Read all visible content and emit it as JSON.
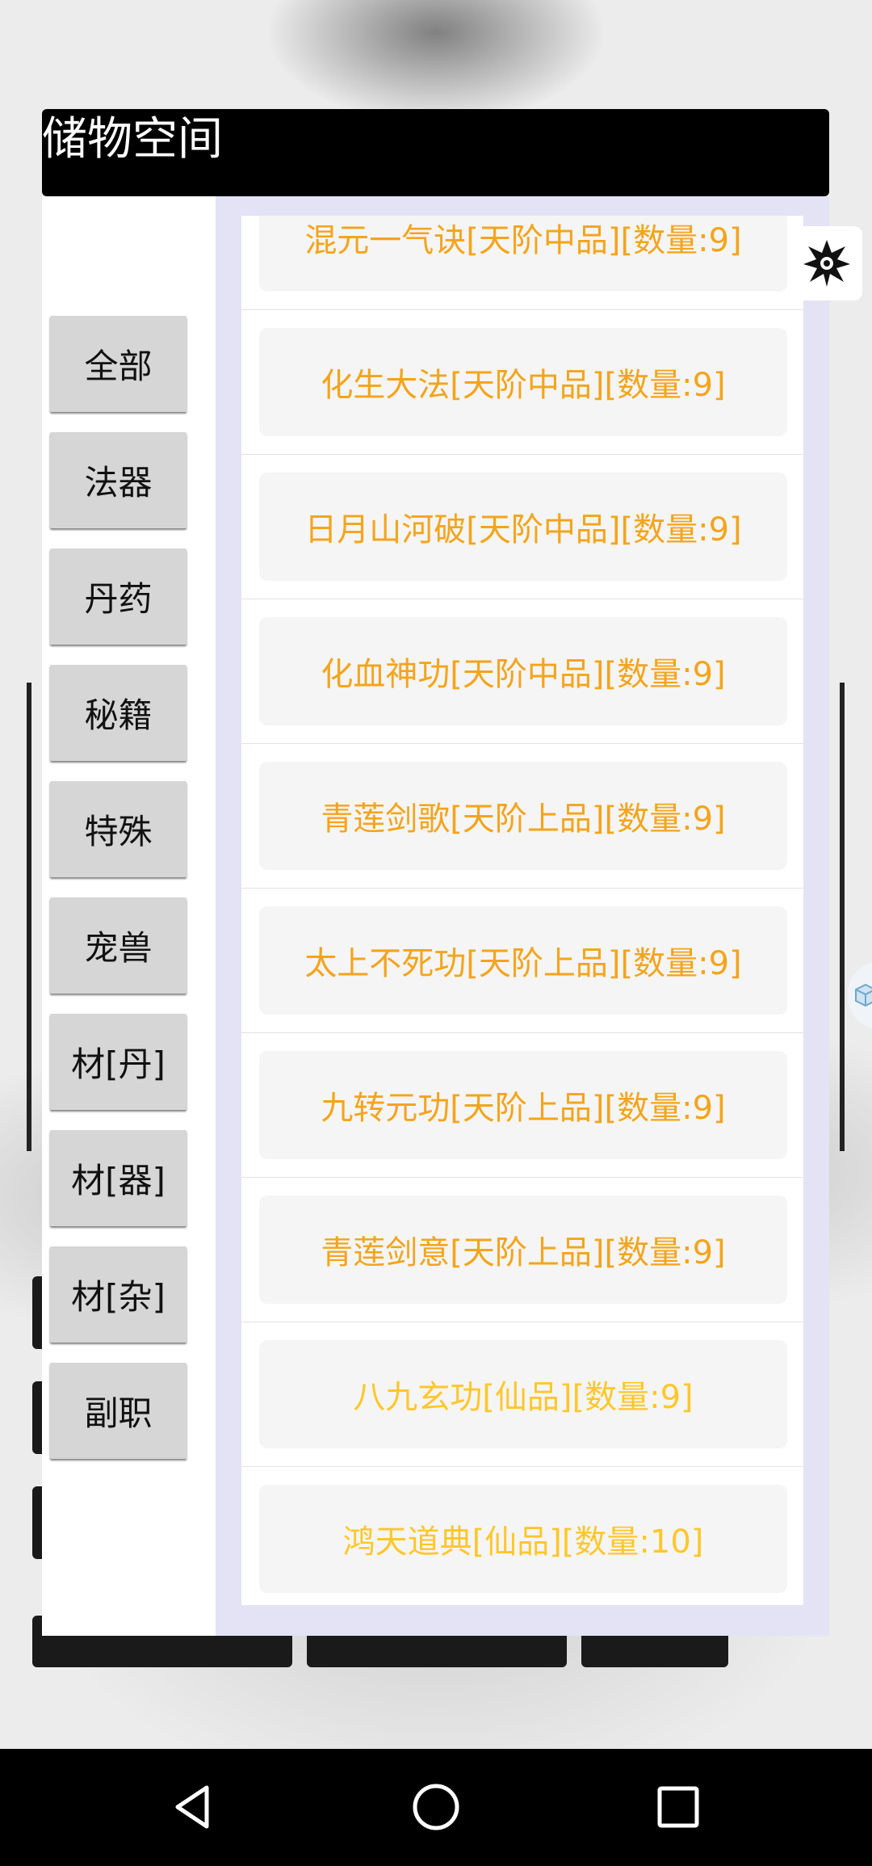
{
  "title": "储物空间",
  "categories": [
    {
      "label": "全部"
    },
    {
      "label": "法器"
    },
    {
      "label": "丹药"
    },
    {
      "label": "秘籍"
    },
    {
      "label": "特殊"
    },
    {
      "label": "宠兽"
    },
    {
      "label": "材[丹]"
    },
    {
      "label": "材[器]"
    },
    {
      "label": "材[杂]"
    },
    {
      "label": "副职"
    }
  ],
  "items": [
    {
      "label": "混元一气诀[天阶中品][数量:9]"
    },
    {
      "label": "化生大法[天阶中品][数量:9]"
    },
    {
      "label": "日月山河破[天阶中品][数量:9]"
    },
    {
      "label": "化血神功[天阶中品][数量:9]"
    },
    {
      "label": "青莲剑歌[天阶上品][数量:9]"
    },
    {
      "label": "太上不死功[天阶上品][数量:9]"
    },
    {
      "label": "九转元功[天阶上品][数量:9]"
    },
    {
      "label": "青莲剑意[天阶上品][数量:9]"
    },
    {
      "label": "八九玄功[仙品][数量:9]"
    },
    {
      "label": "鸿天道典[仙品][数量:10]"
    }
  ],
  "colors": {
    "item_text_tianjie": "#f4a41c",
    "item_text_xianpin": "#ffc72c",
    "title_bar": "#000000",
    "list_border": "#e3e3f5"
  },
  "icons": {
    "floating": "emblem-icon",
    "side_handle": "cube-icon",
    "nav_back": "back-triangle-icon",
    "nav_home": "home-circle-icon",
    "nav_recents": "recents-square-icon"
  }
}
